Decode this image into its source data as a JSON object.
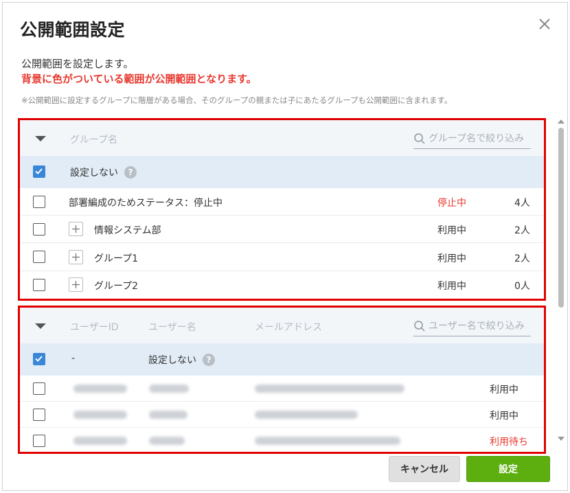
{
  "dialog": {
    "title": "公開範囲設定",
    "description": "公開範囲を設定します。",
    "emphasis": "背景に色がついている範囲が公開範囲となります。",
    "note": "※公開範囲に設定するグループに階層がある場合、そのグループの親または子にあたるグループも公開範囲に含まれます。"
  },
  "groups": {
    "header_name": "グループ名",
    "search_placeholder": "グループ名で絞り込み",
    "no_setting": {
      "label": "設定しない",
      "checked": true
    },
    "rows": [
      {
        "name": "部署編成のためステータス：停止中",
        "status": "停止中",
        "count": "4人",
        "has_children": false,
        "status_color": "#e8382f"
      },
      {
        "name": "情報システム部",
        "status": "利用中",
        "count": "2人",
        "has_children": true
      },
      {
        "name": "グループ1",
        "status": "利用中",
        "count": "2人",
        "has_children": true
      },
      {
        "name": "グループ2",
        "status": "利用中",
        "count": "0人",
        "has_children": true
      }
    ]
  },
  "users": {
    "header_id": "ユーザーID",
    "header_name": "ユーザー名",
    "header_email": "メールアドレス",
    "search_placeholder": "ユーザー名で絞り込み",
    "no_setting": {
      "id": "-",
      "label": "設定しない",
      "checked": true
    },
    "rows": [
      {
        "status": "利用中",
        "redacted": true
      },
      {
        "status": "利用中",
        "redacted": true
      },
      {
        "status": "利用待ち",
        "redacted": true,
        "status_color": "#e8382f"
      }
    ]
  },
  "buttons": {
    "cancel": "キャンセル",
    "ok": "設定"
  },
  "colors": {
    "accent_red": "#e8382f",
    "selected_bg": "#e1ecf7",
    "primary_green": "#5dae0f",
    "checkbox_blue": "#3a86d9",
    "highlight_border": "#e10000"
  }
}
